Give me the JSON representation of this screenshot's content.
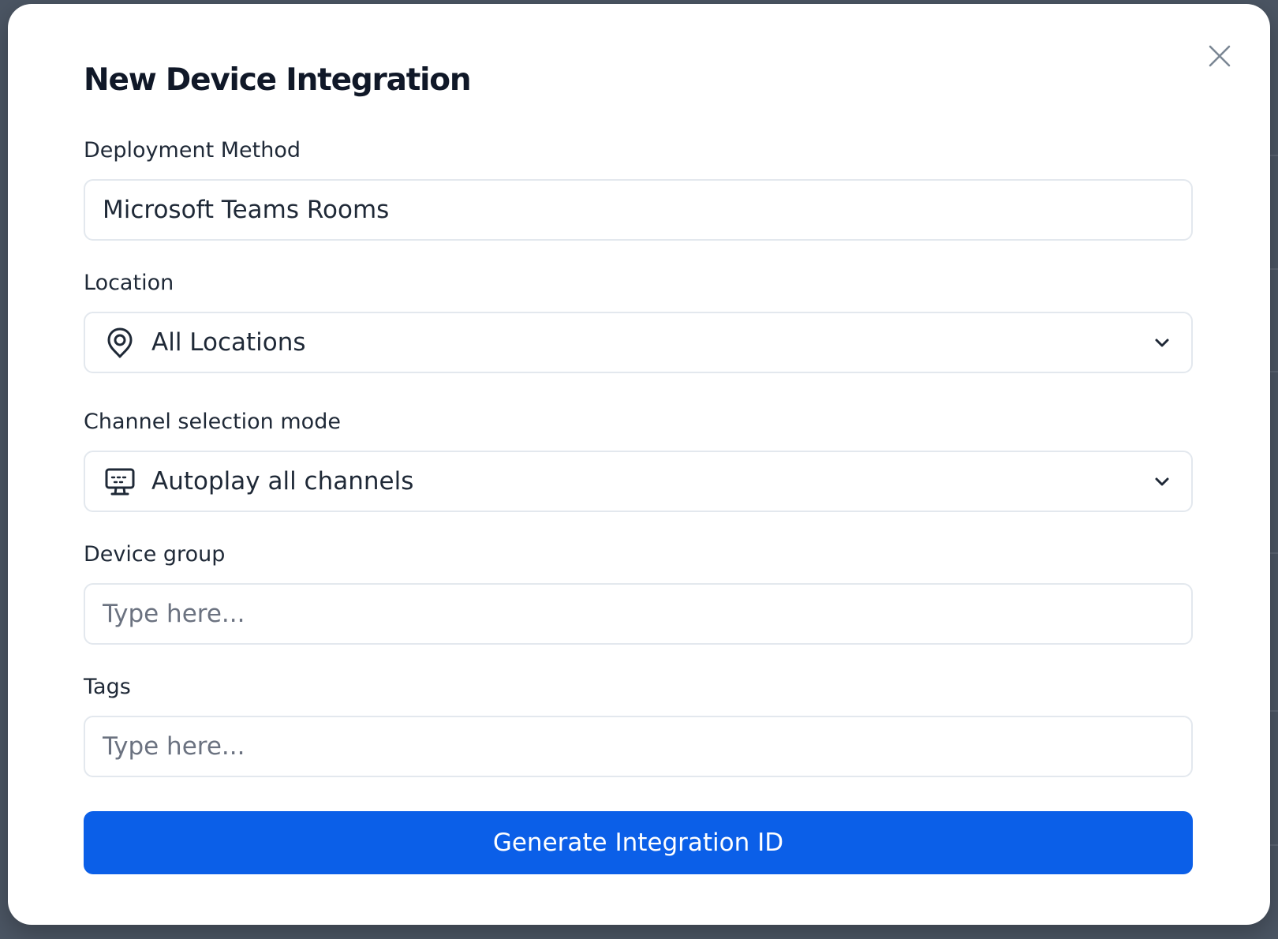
{
  "modal": {
    "title": "New Device Integration",
    "close_icon": "close-icon"
  },
  "fields": {
    "deployment_method": {
      "label": "Deployment Method",
      "value": "Microsoft Teams Rooms"
    },
    "location": {
      "label": "Location",
      "value": "All Locations",
      "icon": "map-pin-icon"
    },
    "channel_mode": {
      "label": "Channel selection mode",
      "value": "Autoplay all channels",
      "icon": "monitor-icon"
    },
    "device_group": {
      "label": "Device group",
      "placeholder": "Type here..."
    },
    "tags": {
      "label": "Tags",
      "placeholder": "Type here..."
    }
  },
  "actions": {
    "generate_label": "Generate Integration ID"
  },
  "colors": {
    "primary": "#0b5fe8",
    "text": "#1f2937",
    "border": "#e3e8ee",
    "backdrop": "#4b5563"
  }
}
